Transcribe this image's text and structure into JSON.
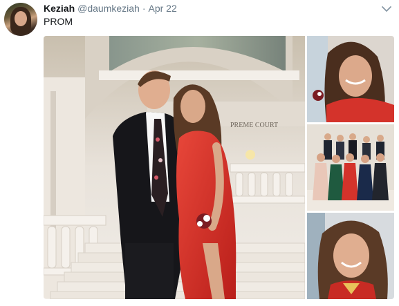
{
  "tweet": {
    "display_name": "Keziah",
    "handle": "@daumkeziah",
    "separator": "·",
    "date": "Apr 22",
    "text": "PROM",
    "wall_sign": "PREME COURT"
  },
  "icons": {
    "caret": "chevron-down-icon"
  },
  "colors": {
    "name": "#14171a",
    "muted": "#657786",
    "dress_red": "#d8312a",
    "marble": "#e9e4de"
  }
}
